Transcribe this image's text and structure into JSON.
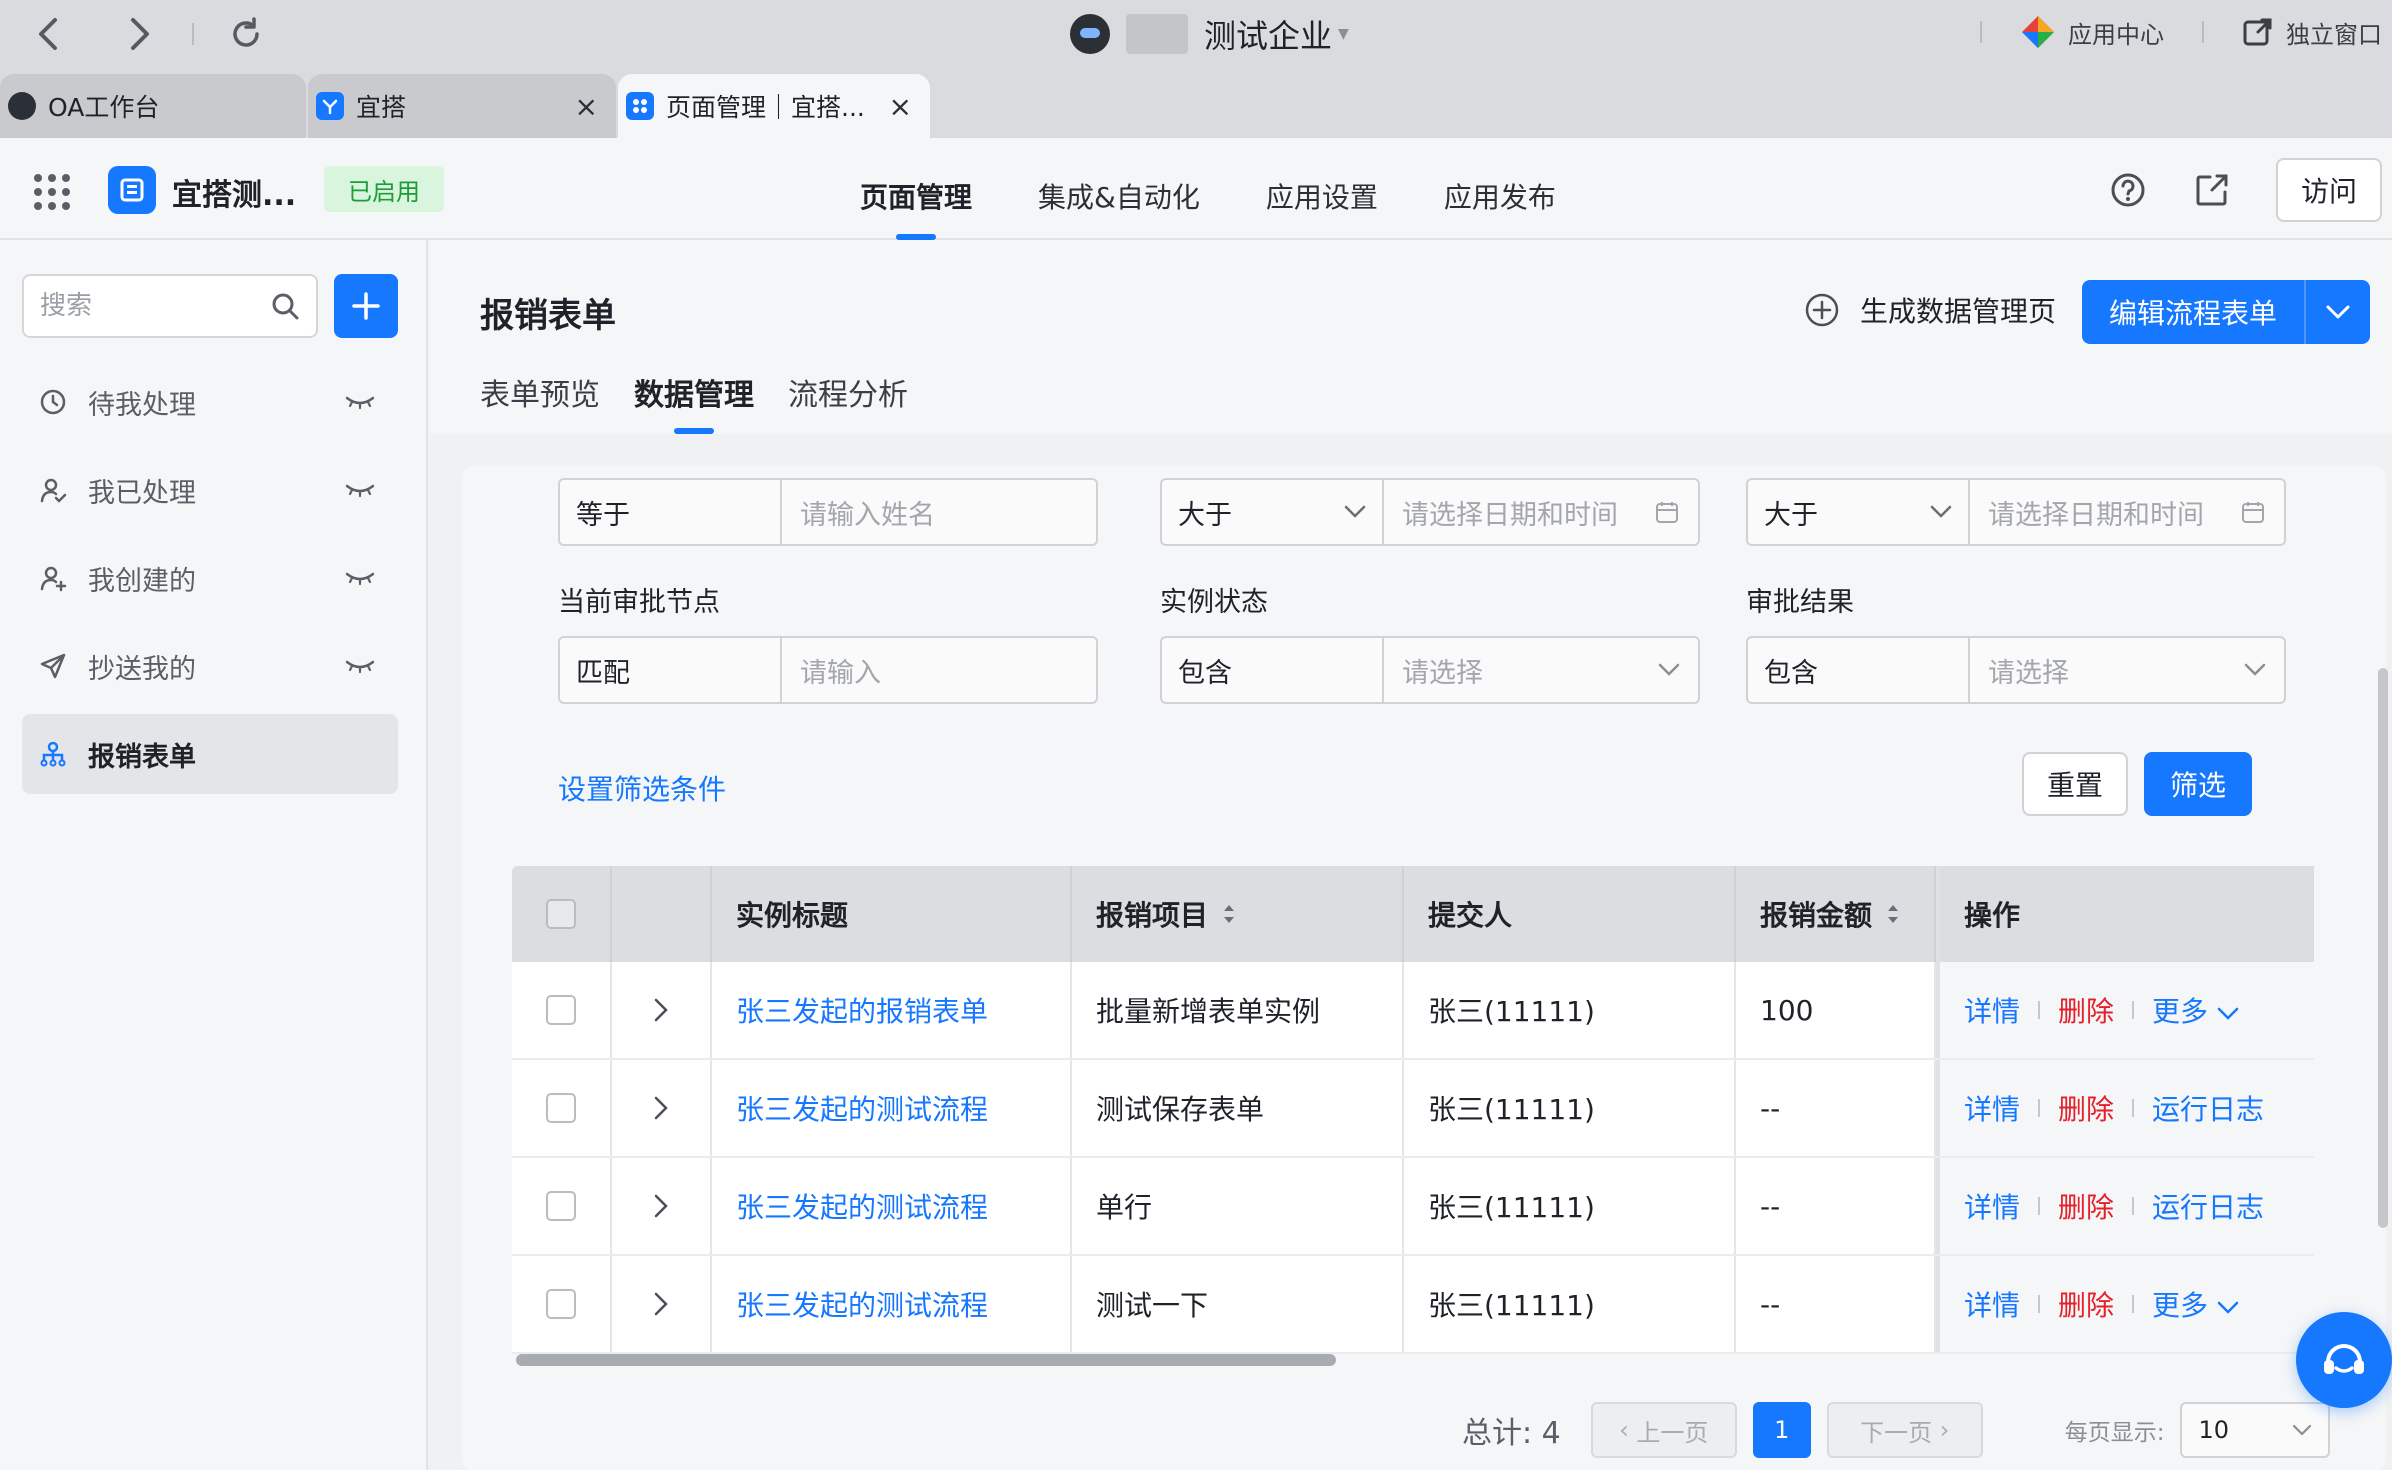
{
  "browser": {
    "company_name": "测试企业",
    "app_center": "应用中心",
    "standalone_window": "独立窗口",
    "tabs": [
      {
        "label": "OA工作台"
      },
      {
        "label": "宜搭"
      },
      {
        "label": "页面管理｜宜搭..."
      }
    ]
  },
  "app": {
    "name": "宜搭测...",
    "status_badge": "已启用",
    "nav": [
      "页面管理",
      "集成&自动化",
      "应用设置",
      "应用发布"
    ],
    "visit": "访问"
  },
  "sidebar": {
    "search_placeholder": "搜索",
    "items": [
      {
        "label": "待我处理",
        "icon": "clock-icon"
      },
      {
        "label": "我已处理",
        "icon": "user-check-icon"
      },
      {
        "label": "我创建的",
        "icon": "user-add-icon"
      },
      {
        "label": "抄送我的",
        "icon": "send-icon"
      },
      {
        "label": "报销表单",
        "icon": "org-chart-icon"
      }
    ]
  },
  "content": {
    "title": "报销表单",
    "generate_page": "生成数据管理页",
    "edit_form": "编辑流程表单",
    "sub_tabs": [
      "表单预览",
      "数据管理",
      "流程分析"
    ]
  },
  "filters": {
    "row1": [
      {
        "op": "等于",
        "placeholder": "请输入姓名"
      },
      {
        "op": "大于",
        "placeholder": "请选择日期和时间"
      },
      {
        "op": "大于",
        "placeholder": "请选择日期和时间"
      }
    ],
    "row2_labels": [
      "当前审批节点",
      "实例状态",
      "审批结果"
    ],
    "row2": [
      {
        "op": "匹配",
        "placeholder": "请输入"
      },
      {
        "op": "包含",
        "placeholder": "请选择"
      },
      {
        "op": "包含",
        "placeholder": "请选择"
      }
    ],
    "set_conditions": "设置筛选条件",
    "reset": "重置",
    "apply": "筛选"
  },
  "table": {
    "columns": [
      "实例标题",
      "报销项目",
      "提交人",
      "报销金额",
      "操作"
    ],
    "rows": [
      {
        "title": "张三发起的报销表单",
        "item": "批量新增表单实例",
        "user": "张三(11111)",
        "amount": "100",
        "ops": [
          "详情",
          "删除",
          "更多"
        ]
      },
      {
        "title": "张三发起的测试流程",
        "item": "测试保存表单",
        "user": "张三(11111)",
        "amount": "--",
        "ops": [
          "详情",
          "删除",
          "运行日志"
        ]
      },
      {
        "title": "张三发起的测试流程",
        "item": "单行",
        "user": "张三(11111)",
        "amount": "--",
        "ops": [
          "详情",
          "删除",
          "运行日志"
        ]
      },
      {
        "title": "张三发起的测试流程",
        "item": "测试一下",
        "user": "张三(11111)",
        "amount": "--",
        "ops": [
          "详情",
          "删除",
          "更多"
        ]
      }
    ]
  },
  "pagination": {
    "total": "总计: 4",
    "prev": "上一页",
    "current": "1",
    "next": "下一页",
    "page_size_label": "每页显示:",
    "page_size": "10"
  },
  "colors": {
    "primary": "#1677ff",
    "danger": "#e5202b",
    "success": "#1d9d3a"
  }
}
